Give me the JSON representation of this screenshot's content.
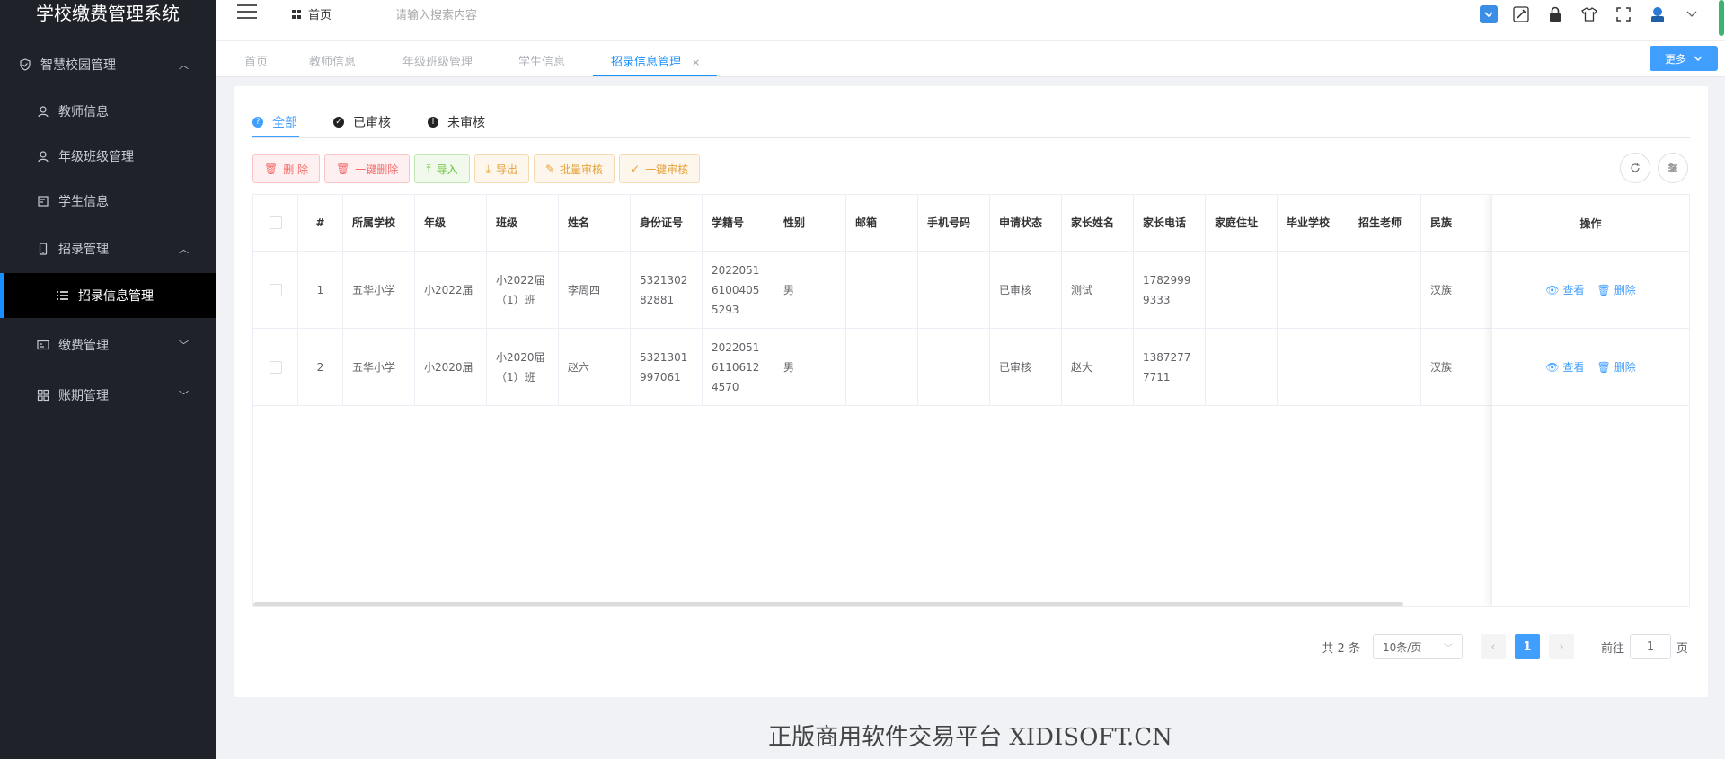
{
  "app": {
    "title": "学校缴费管理系统"
  },
  "sidebar": {
    "items": [
      {
        "label": "智慧校园管理",
        "icon": "shield-icon"
      },
      {
        "label": "教师信息",
        "icon": "user-icon"
      },
      {
        "label": "年级班级管理",
        "icon": "user-icon"
      },
      {
        "label": "学生信息",
        "icon": "edit-icon"
      },
      {
        "label": "招录管理",
        "icon": "phone-icon"
      },
      {
        "label": "招录信息管理",
        "icon": "list-icon"
      },
      {
        "label": "缴费管理",
        "icon": "card-icon"
      },
      {
        "label": "账期管理",
        "icon": "grid-icon"
      }
    ]
  },
  "header": {
    "home": "首页",
    "search_placeholder": "请输入搜索内容"
  },
  "tabs": {
    "items": [
      "首页",
      "教师信息",
      "年级班级管理",
      "学生信息",
      "招录信息管理"
    ],
    "close": "×",
    "more": "更多"
  },
  "subtabs": [
    "全部",
    "已审核",
    "未审核"
  ],
  "toolbar": {
    "delete": "删 除",
    "bulk_delete": "一键删除",
    "import": "导入",
    "export": "导出",
    "batch_review": "批量审核",
    "one_click_review": "一键审核"
  },
  "table": {
    "columns": [
      "#",
      "所属学校",
      "年级",
      "班级",
      "姓名",
      "身份证号",
      "学籍号",
      "性别",
      "邮箱",
      "手机号码",
      "申请状态",
      "家长姓名",
      "家长电话",
      "家庭住址",
      "毕业学校",
      "招生老师",
      "民族"
    ],
    "ops_header": "操作",
    "ops": {
      "view": "查看",
      "delete": "删除"
    },
    "rows": [
      {
        "idx": "1",
        "school": "五华小学",
        "grade": "小2022届",
        "class": "小2022届（1）班",
        "name": "李周四",
        "id_card": "532130282881",
        "student_no": "202205161004055293",
        "gender": "男",
        "email": "",
        "phone": "",
        "status": "已审核",
        "parent": "测试",
        "parent_phone": "17829999333",
        "address": "",
        "grad_school": "",
        "teacher": "",
        "ethnic": "汉族"
      },
      {
        "idx": "2",
        "school": "五华小学",
        "grade": "小2020届",
        "class": "小2020届（1）班",
        "name": "赵六",
        "id_card": "5321301997061",
        "student_no": "202205161106124570",
        "gender": "男",
        "email": "",
        "phone": "",
        "status": "已审核",
        "parent": "赵大",
        "parent_phone": "13872777711",
        "address": "",
        "grad_school": "",
        "teacher": "",
        "ethnic": "汉族"
      }
    ]
  },
  "pagination": {
    "total": "共 2 条",
    "page_size": "10条/页",
    "current": "1",
    "goto_label": "前往",
    "goto_value": "1",
    "page_unit": "页"
  },
  "footer": "正版商用软件交易平台 XIDISOFT.CN"
}
